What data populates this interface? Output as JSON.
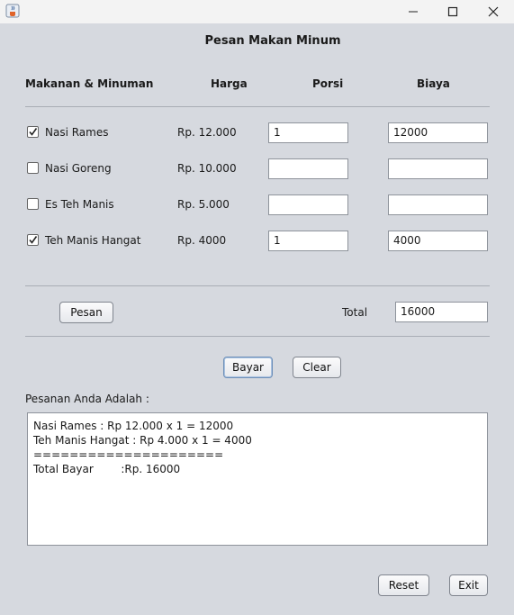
{
  "window": {
    "icon": "java-cup-icon",
    "controls": [
      "minimize-icon",
      "maximize-icon",
      "close-icon"
    ]
  },
  "heading": "Pesan Makan Minum",
  "columns": {
    "item": "Makanan & Minuman",
    "price": "Harga",
    "portion": "Porsi",
    "cost": "Biaya"
  },
  "items": [
    {
      "name": "Nasi Rames",
      "price": "Rp. 12.000",
      "checked": true,
      "portion": "1",
      "cost": "12000"
    },
    {
      "name": "Nasi Goreng",
      "price": "Rp. 10.000",
      "checked": false,
      "portion": "",
      "cost": ""
    },
    {
      "name": "Es Teh Manis",
      "price": "Rp. 5.000",
      "checked": false,
      "portion": "",
      "cost": ""
    },
    {
      "name": "Teh Manis Hangat",
      "price": "Rp. 4000",
      "checked": true,
      "portion": "1",
      "cost": "4000"
    }
  ],
  "order_button": "Pesan",
  "total": {
    "label": "Total",
    "value": "16000"
  },
  "pay_button": "Bayar",
  "clear_button": "Clear",
  "summary_label": "Pesanan Anda Adalah :",
  "summary_lines": [
    "Nasi Rames : Rp 12.000 x 1 = 12000",
    "Teh Manis Hangat : Rp 4.000 x 1 = 4000",
    "=====================",
    "Total Bayar        :Rp. 16000"
  ],
  "reset_button": "Reset",
  "exit_button": "Exit",
  "colors": {
    "background": "#d6d9df",
    "titlebar": "#f3f3f3",
    "focus": "#6d8fb8"
  }
}
